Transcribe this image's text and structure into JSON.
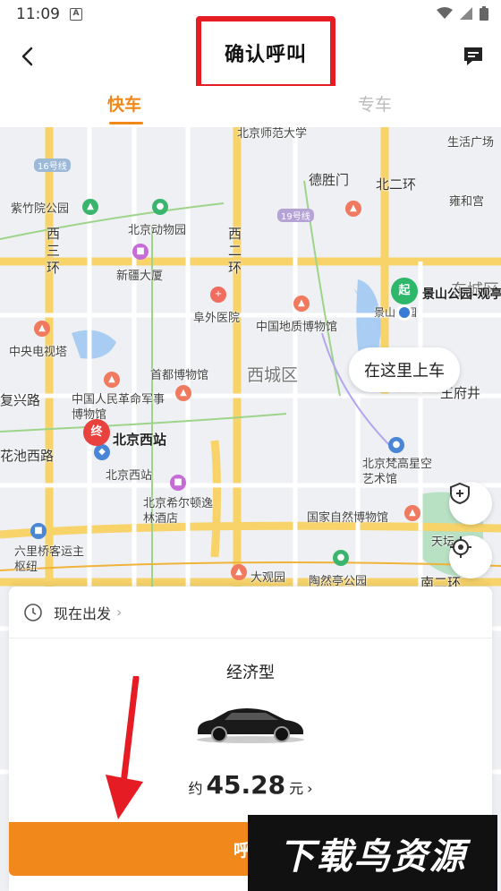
{
  "status_bar": {
    "time": "11:09",
    "notif": "A"
  },
  "header": {
    "title": "确认呼叫"
  },
  "tabs": [
    {
      "label": "快车"
    },
    {
      "label": "专车"
    }
  ],
  "map": {
    "bubble": "在这里上车",
    "start_pin": "起",
    "end_pin": "终",
    "start_name": "景山公园-观亭",
    "end_name": "北京西站",
    "labels": {
      "beijing_normal": "北京师范大学",
      "shengli_men": "德胜门",
      "bei_er_huan": "北二环",
      "shenghuo_guangchang": "生活广场",
      "yonghe_gong": "雍和宫",
      "zizhuyuan": "紫竹院公园",
      "dongwuyuan": "北京动物园",
      "xi_er_huan_1": "西二环",
      "xi_san_huan": "西三环",
      "xinjiang_dasha": "新疆大厦",
      "fuwai_yiyuan": "阜外医院",
      "dizhi_bowuguan": "中国地质博物馆",
      "jingshan_yuan": "景山公园",
      "dongcheng": "东城区",
      "cctv": "中央电视塔",
      "shoudu_bowuguan": "首都博物馆",
      "xicheng": "西城区",
      "fuxing_lu": "复兴路",
      "junshi_bowuguan": "中国人民革命军事博物馆",
      "wangfujing": "王府井",
      "huachi_xilu": "花池西路",
      "beijing_xizhan_small": "北京西站",
      "fanhua": "北京梵高星空艺术馆",
      "xierdun": "北京希尔顿逸林酒店",
      "ziran_bowuguan": "国家自然博物馆",
      "liuliqiao": "六里桥客运主枢纽",
      "daguanyuan": "大观园",
      "taoranting": "陶然亭公园",
      "tiantan": "天坛",
      "nan_er_huan": "南二环",
      "sishihao": "16号线",
      "shijiuhao": "19号线"
    }
  },
  "sheet": {
    "depart_label": "现在出发",
    "car_type": "经济型",
    "price_prefix": "约",
    "price_value": "45.28",
    "price_unit": "元",
    "call_label": "呼叫"
  },
  "watermark": "下载鸟资源",
  "colors": {
    "accent": "#f0881c",
    "start": "#2db76b",
    "end": "#e9413e",
    "highlight": "#e51c24"
  }
}
